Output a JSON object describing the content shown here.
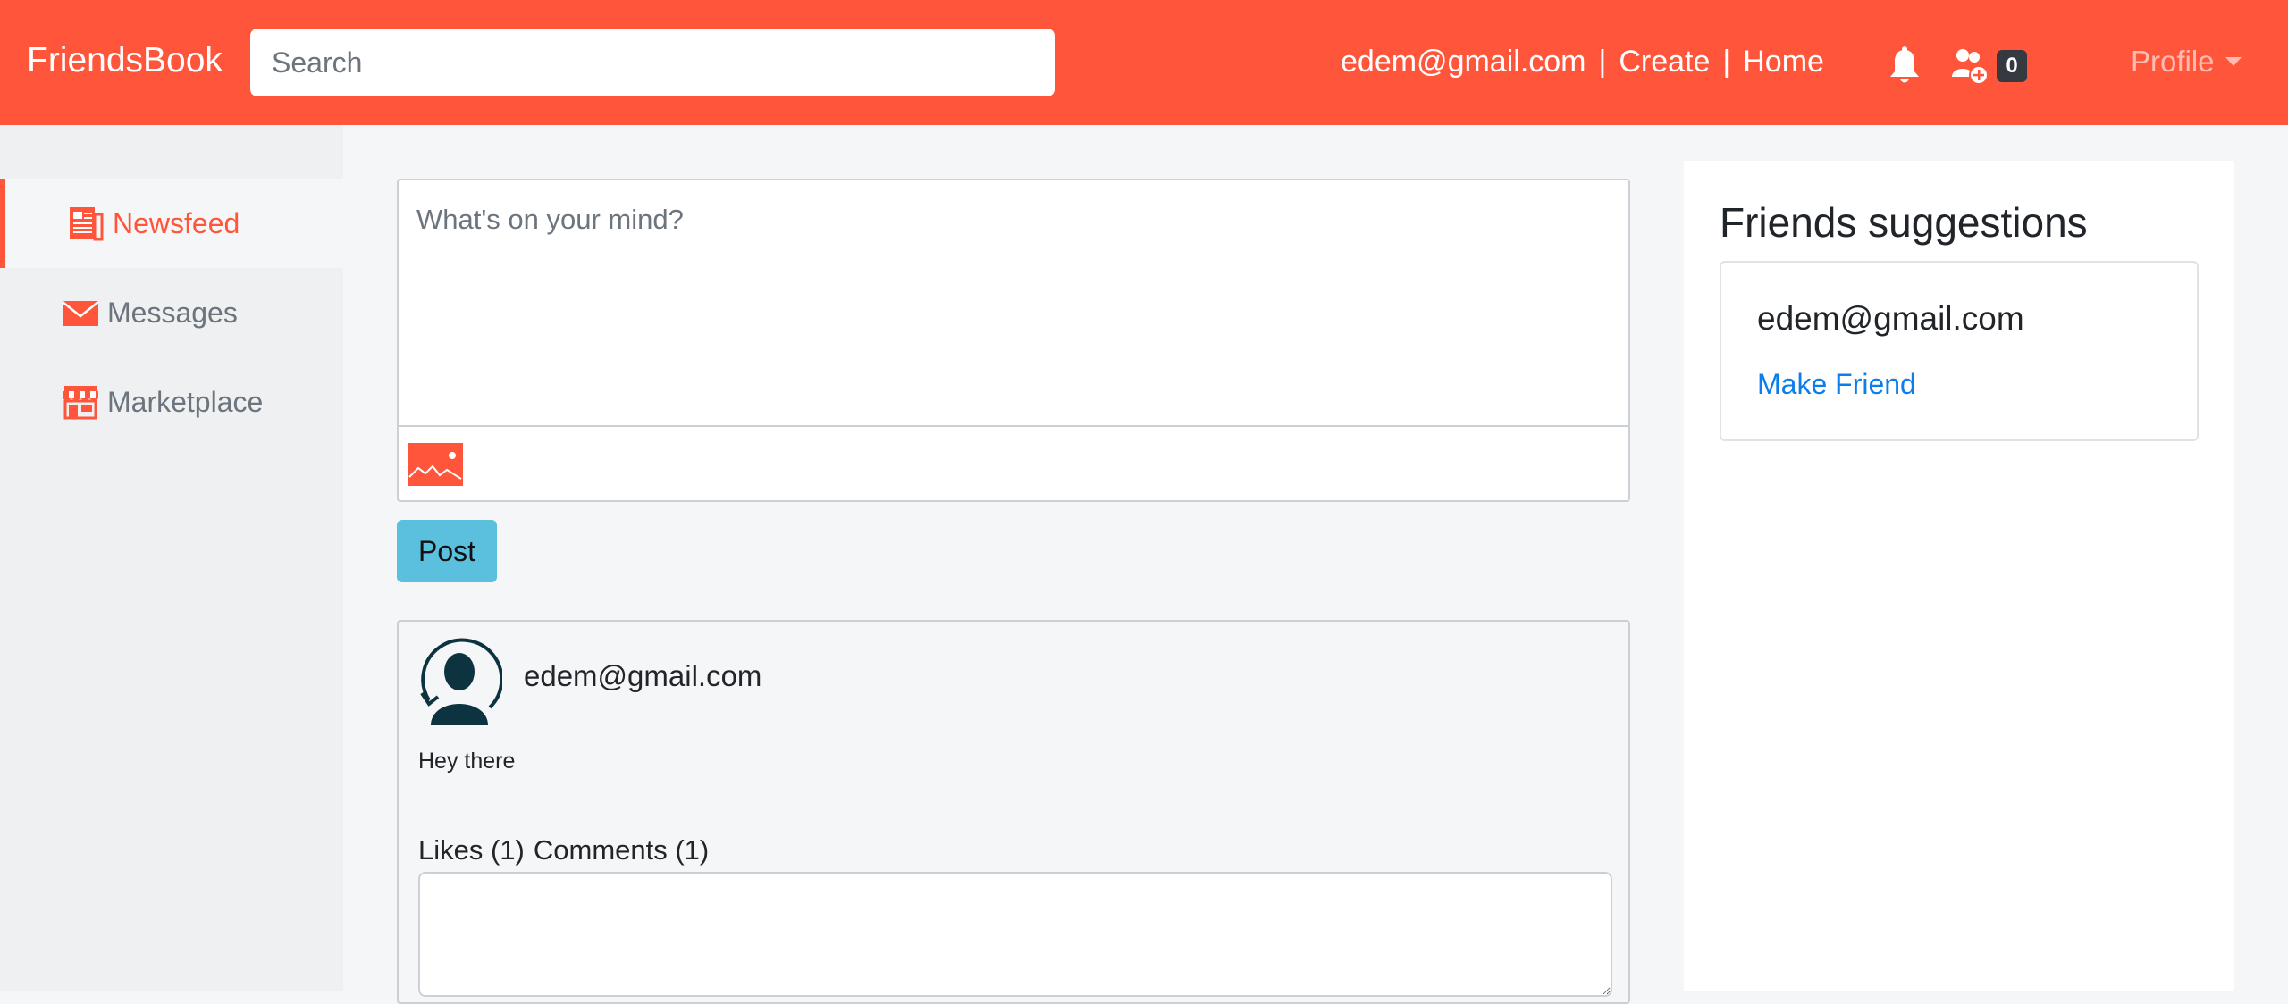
{
  "navbar": {
    "brand": "FriendsBook",
    "search_placeholder": "Search",
    "user_email": "edem@gmail.com",
    "separator": "|",
    "create_link": "Create",
    "home_link": "Home",
    "friend_requests_count": "0",
    "profile_label": "Profile"
  },
  "sidebar": {
    "items": [
      {
        "label": "Newsfeed",
        "icon": "newspaper-icon"
      },
      {
        "label": "Messages",
        "icon": "envelope-icon"
      },
      {
        "label": "Marketplace",
        "icon": "store-icon"
      }
    ]
  },
  "composer": {
    "placeholder": "What's on your mind?",
    "post_button": "Post"
  },
  "post": {
    "author": "edem@gmail.com",
    "text": "Hey there",
    "likes_label": "Likes (1)",
    "comments_label": "Comments (1)"
  },
  "suggestions": {
    "title": "Friends suggestions",
    "items": [
      {
        "email": "edem@gmail.com",
        "action": "Make Friend"
      }
    ]
  },
  "colors": {
    "accent": "#ff563b",
    "post_button": "#5bc0de",
    "link": "#0d7ee9"
  }
}
